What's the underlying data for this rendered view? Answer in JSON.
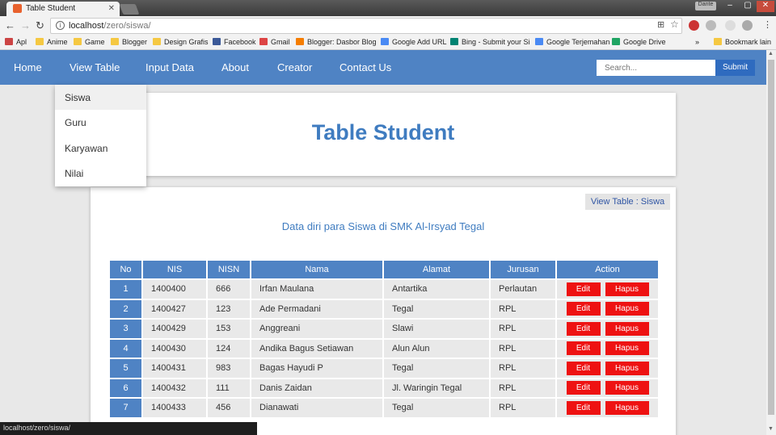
{
  "browser": {
    "tab_title": "Table Student",
    "url_host": "localhost",
    "url_path": "/zero/siswa/",
    "user_label": "Dante",
    "bookmarks": [
      {
        "label": "Apl",
        "icon": "apps-icon"
      },
      {
        "label": "Anime",
        "icon": "folder-icon"
      },
      {
        "label": "Game",
        "icon": "folder-icon"
      },
      {
        "label": "Blogger",
        "icon": "folder-icon"
      },
      {
        "label": "Design Grafis",
        "icon": "folder-icon"
      },
      {
        "label": "Facebook",
        "icon": "facebook-icon"
      },
      {
        "label": "Gmail",
        "icon": "gmail-icon"
      },
      {
        "label": "Blogger: Dasbor Blog",
        "icon": "blogger-icon"
      },
      {
        "label": "Google Add URL",
        "icon": "google-icon"
      },
      {
        "label": "Bing - Submit your Si",
        "icon": "bing-icon"
      },
      {
        "label": "Google Terjemahan",
        "icon": "google-icon"
      },
      {
        "label": "Google Drive",
        "icon": "drive-icon"
      },
      {
        "label": "»",
        "icon": "overflow-icon"
      },
      {
        "label": "Bookmark lain",
        "icon": "folder-icon"
      }
    ],
    "status_url": "localhost/zero/siswa/"
  },
  "nav": {
    "items": [
      "Home",
      "View Table",
      "Input Data",
      "About",
      "Creator",
      "Contact Us"
    ],
    "search_placeholder": "Search...",
    "submit_label": "Submit",
    "dropdown": [
      "Siswa",
      "Guru",
      "Karyawan",
      "Nilai"
    ]
  },
  "header": {
    "title": "Table Student"
  },
  "content": {
    "breadcrumb": "View Table : Siswa",
    "subtitle": "Data diri para Siswa di SMK Al-Irsyad Tegal",
    "columns": [
      "No",
      "NIS",
      "NISN",
      "Nama",
      "Alamat",
      "Jurusan",
      "Action"
    ],
    "rows": [
      {
        "no": "1",
        "nis": "1400400",
        "nisn": "666",
        "nama": "Irfan Maulana",
        "alamat": "Antartika",
        "jurusan": "Perlautan"
      },
      {
        "no": "2",
        "nis": "1400427",
        "nisn": "123",
        "nama": "Ade Permadani",
        "alamat": "Tegal",
        "jurusan": "RPL"
      },
      {
        "no": "3",
        "nis": "1400429",
        "nisn": "153",
        "nama": "Anggreani",
        "alamat": "Slawi",
        "jurusan": "RPL"
      },
      {
        "no": "4",
        "nis": "1400430",
        "nisn": "124",
        "nama": "Andika Bagus Setiawan",
        "alamat": "Alun Alun",
        "jurusan": "RPL"
      },
      {
        "no": "5",
        "nis": "1400431",
        "nisn": "983",
        "nama": "Bagas Hayudi P",
        "alamat": "Tegal",
        "jurusan": "RPL"
      },
      {
        "no": "6",
        "nis": "1400432",
        "nisn": "111",
        "nama": "Danis Zaidan",
        "alamat": "Jl. Waringin Tegal",
        "jurusan": "RPL"
      },
      {
        "no": "7",
        "nis": "1400433",
        "nisn": "456",
        "nama": "Dianawati",
        "alamat": "Tegal",
        "jurusan": "RPL"
      }
    ],
    "edit_label": "Edit",
    "delete_label": "Hapus"
  },
  "colors": {
    "nav_blue": "#4f83c4",
    "title_blue": "#3f7cc0",
    "action_red": "#ee1212"
  }
}
